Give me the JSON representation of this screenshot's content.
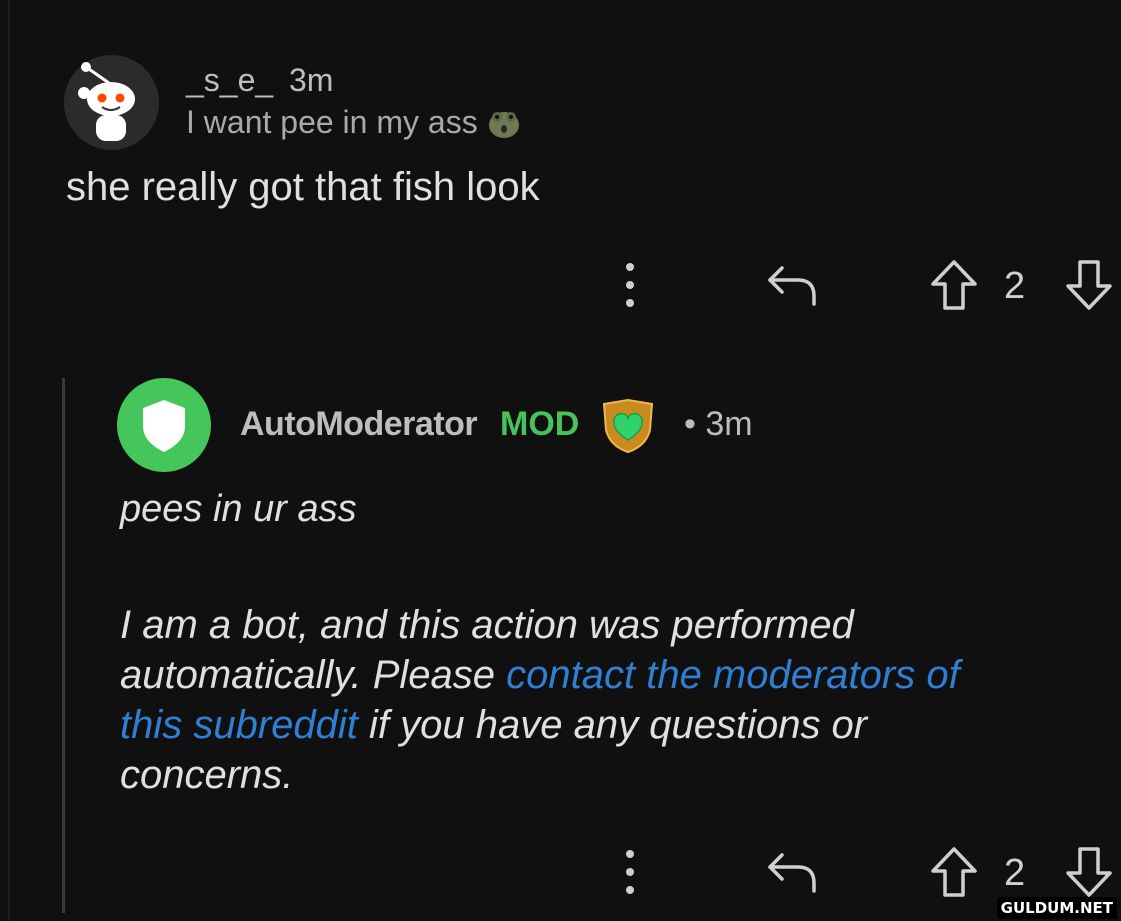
{
  "comment": {
    "username": "_s_e_",
    "time": "3m",
    "flair": "I want pee in my ass",
    "flair_emoji": "frog-face",
    "body": "she really got that fish look",
    "votes": "2"
  },
  "reply": {
    "username": "AutoModerator",
    "mod_badge": "MOD",
    "time": "• 3m",
    "award_icon": "green-heart-shield",
    "body_line": "pees in ur ass",
    "bot_text_1": "I am a bot, and this action was performed automatically. Please ",
    "bot_link": "contact the moderators of this subreddit",
    "bot_text_2": " if you have any questions or concerns.",
    "votes": "2"
  },
  "icons": {
    "more": "more-vertical-icon",
    "reply": "reply-arrow-icon",
    "upvote": "upvote-arrow-icon",
    "downvote": "downvote-arrow-icon"
  },
  "colors": {
    "background": "#101010",
    "mod_green": "#46c45b",
    "link_blue": "#2f7fd4"
  },
  "watermark": "GULDUM.NET"
}
